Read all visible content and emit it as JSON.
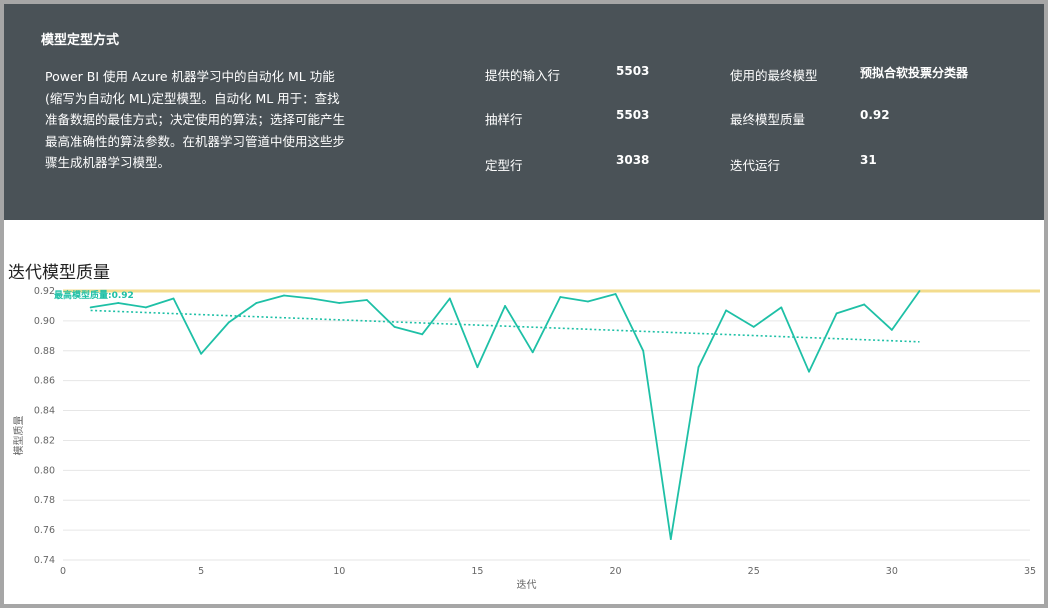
{
  "header": {
    "title": "模型定型方式",
    "description": "Power BI 使用 Azure 机器学习中的自动化 ML 功能(缩写为自动化 ML)定型模型。自动化 ML 用于：查找准备数据的最佳方式；决定使用的算法；选择可能产生最高准确性的算法参数。在机器学习管道中使用这些步骤生成机器学习模型。",
    "stats_left": [
      {
        "label": "提供的输入行",
        "value": "5503"
      },
      {
        "label": "抽样行",
        "value": "5503"
      },
      {
        "label": "定型行",
        "value": "3038"
      }
    ],
    "stats_right": [
      {
        "label": "使用的最终模型",
        "value": "预拟合软投票分类器"
      },
      {
        "label": "最终模型质量",
        "value": "0.92"
      },
      {
        "label": "迭代运行",
        "value": "31"
      }
    ]
  },
  "chart_data": {
    "type": "line",
    "title": "迭代模型质量",
    "xlabel": "迭代",
    "ylabel": "模型质量",
    "xlim": [
      0,
      35
    ],
    "ylim": [
      0.74,
      0.92
    ],
    "x_ticks": [
      0,
      5,
      10,
      15,
      20,
      25,
      30,
      35
    ],
    "y_ticks": [
      0.74,
      0.76,
      0.78,
      0.8,
      0.82,
      0.84,
      0.86,
      0.88,
      0.9,
      0.92
    ],
    "grid": true,
    "series": [
      {
        "x": [
          1,
          2,
          3,
          4,
          5,
          6,
          7,
          8,
          9,
          10,
          11,
          12,
          13,
          14,
          15,
          16,
          17,
          18,
          19,
          20,
          21,
          22,
          23,
          24,
          25,
          26,
          27,
          28,
          29,
          30,
          31
        ],
        "values": [
          0.909,
          0.912,
          0.909,
          0.915,
          0.878,
          0.899,
          0.912,
          0.917,
          0.915,
          0.912,
          0.914,
          0.896,
          0.891,
          0.915,
          0.869,
          0.91,
          0.879,
          0.916,
          0.913,
          0.918,
          0.88,
          0.754,
          0.869,
          0.907,
          0.896,
          0.909,
          0.866,
          0.905,
          0.911,
          0.894,
          0.92
        ],
        "color": "#1ec0a6"
      }
    ],
    "trendline": {
      "start": [
        1,
        0.907
      ],
      "end": [
        31,
        0.886
      ],
      "color": "#1ec0a6",
      "style": "dotted"
    },
    "best_line": {
      "value": 0.92,
      "label": "最高模型质量:0.92",
      "line_color": "#f3dc8e"
    }
  }
}
